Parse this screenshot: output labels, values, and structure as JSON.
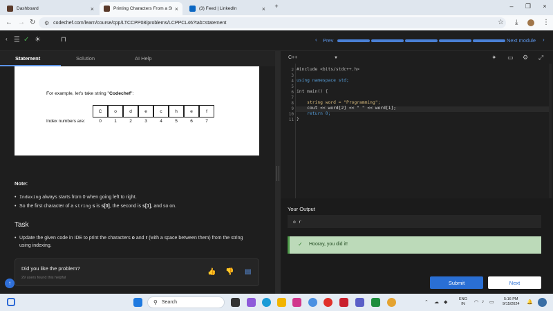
{
  "browser": {
    "tabs": [
      {
        "title": "Dashboard",
        "favicon": "codechef",
        "active": false
      },
      {
        "title": "Printing Characters From a Strin",
        "favicon": "codechef",
        "active": true
      },
      {
        "title": "(3) Feed | LinkedIn",
        "favicon": "linkedin",
        "active": false
      }
    ],
    "url": "codechef.com/learn/course/cpp/LTCCPP08/problems/LCPPCL46?tab=statement"
  },
  "header": {
    "prev_label": "Prev",
    "next_module_label": "Next module"
  },
  "left_tabs": [
    {
      "label": "Statement",
      "active": true
    },
    {
      "label": "Solution",
      "active": false
    },
    {
      "label": "AI Help",
      "active": false
    }
  ],
  "statement": {
    "example_prefix": "For example, let's take string \"",
    "example_word": "Codechef",
    "example_suffix": "\":",
    "chars": [
      "C",
      "o",
      "d",
      "e",
      "c",
      "h",
      "e",
      "f"
    ],
    "index_label": "Index numbers are:",
    "indices": [
      "0",
      "1",
      "2",
      "3",
      "4",
      "5",
      "6",
      "7"
    ],
    "note_title": "Note:",
    "note1_code": "Indexing",
    "note1_rest": " always starts from 0 when going left to right.",
    "note2_a": "So the first character of a ",
    "note2_code": "string",
    "note2_b": " s",
    "note2_c": " is ",
    "note2_d": "s[0]",
    "note2_e": ", the second is ",
    "note2_f": "s[1]",
    "note2_g": ", and so on.",
    "task_title": "Task",
    "task_a": "Update the given code in IDE to print the characters ",
    "task_b": "o",
    "task_c": " and ",
    "task_d": "r",
    "task_e": " (with a space between them) from the string using indexing."
  },
  "feedback": {
    "question": "Did you like the problem?",
    "count": "29 users found this helpful"
  },
  "editor": {
    "language": "C++",
    "line_numbers": [
      "2",
      "3",
      "4",
      "5",
      "6",
      "7",
      "8",
      "9",
      "10",
      "11"
    ],
    "lines": [
      "#include <bits/stdc++.h>",
      "",
      "using namespace std;",
      "",
      "int main() {",
      "",
      "    string word = \"Programming\";",
      "    cout << word[2] << \" \" << word[1];",
      "    return 0;",
      "}"
    ]
  },
  "output": {
    "title": "Your Output",
    "value": "o r",
    "success": "Hooray, you did it!"
  },
  "buttons": {
    "submit": "Submit",
    "next": "Next"
  },
  "taskbar": {
    "search": "Search",
    "lang_1": "ENG",
    "lang_2": "IN",
    "time": "5:16 PM",
    "date": "9/15/2024"
  },
  "colors": {
    "accent": "#2a6fd4",
    "success_bg": "#bcdab9",
    "panel_bg": "#1e1e1e"
  }
}
